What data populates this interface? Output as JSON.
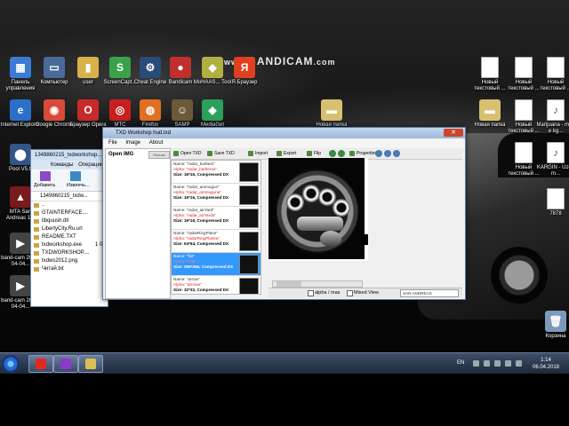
{
  "watermark": {
    "main": "BANDICAM",
    "suffix": ".com",
    "prefix": "www."
  },
  "desktop_icons": [
    {
      "id": "control-panel",
      "label": "Панель управления",
      "color": "#3b7bd6",
      "glyph": "▦"
    },
    {
      "id": "computer",
      "label": "Компьютер",
      "color": "#4a6a9a",
      "glyph": "▭"
    },
    {
      "id": "user",
      "label": "user",
      "color": "#d6b24a",
      "glyph": "▮"
    },
    {
      "id": "screencapture",
      "label": "ScreenCapt...",
      "color": "#3aa04a",
      "glyph": "S"
    },
    {
      "id": "cheat-engine",
      "label": "Cheat Engine",
      "color": "#2a4a7a",
      "glyph": "⚙"
    },
    {
      "id": "bandicam",
      "label": "Bandicam",
      "color": "#c03030",
      "glyph": "●"
    },
    {
      "id": "mohaas-tool",
      "label": "MoHAAS... Tool",
      "color": "#b0b040",
      "glyph": "◆"
    },
    {
      "id": "ya-browser",
      "label": "Я.Браузер",
      "color": "#e04020",
      "glyph": "Я"
    },
    {
      "id": "internet-explorer",
      "label": "Internet Explorer",
      "color": "#2a70c8",
      "glyph": "e"
    },
    {
      "id": "google-chrome",
      "label": "Google Chrome",
      "color": "#d84a3a",
      "glyph": "◉"
    },
    {
      "id": "browser-opera",
      "label": "Браузер Opera",
      "color": "#c82a2a",
      "glyph": "O"
    },
    {
      "id": "mtc",
      "label": "MTC",
      "color": "#c82020",
      "glyph": "◎"
    },
    {
      "id": "firefox",
      "label": "Firefox",
      "color": "#e07020",
      "glyph": "◍"
    },
    {
      "id": "samp",
      "label": "SAMP",
      "color": "#6a5a3a",
      "glyph": "☺"
    },
    {
      "id": "mediaget",
      "label": "MediaGet",
      "color": "#2aa05a",
      "glyph": "◈"
    },
    {
      "id": "pool",
      "label": "Pool V5.0",
      "color": "#335588",
      "glyph": "⬤"
    },
    {
      "id": "mta-san-andreas",
      "label": "MTA San Andreas 1.5",
      "color": "#7a1a1a",
      "glyph": "▲"
    },
    {
      "id": "bandicam-video-1",
      "label": "band-cam 2018-04-04...",
      "color": "#444444",
      "glyph": "▶"
    },
    {
      "id": "bandicam-video-2",
      "label": "band-cam 2018-04-04...",
      "color": "#444444",
      "glyph": "▶"
    },
    {
      "id": "new-folder-1",
      "label": "Новая папка",
      "color": "#d8c070",
      "glyph": "▬"
    },
    {
      "id": "new-doc-1",
      "label": "Новый текстовый ...",
      "color": "#ffffff",
      "glyph": ""
    },
    {
      "id": "new-doc-2",
      "label": "Новый текстовый ...",
      "color": "#ffffff",
      "glyph": ""
    },
    {
      "id": "new-doc-3",
      "label": "Новый текстовый ...",
      "color": "#ffffff",
      "glyph": ""
    },
    {
      "id": "new-folder-2",
      "label": "Новая папка",
      "color": "#d8c070",
      "glyph": "▬"
    },
    {
      "id": "new-doc-4",
      "label": "Новый текстовый ...",
      "color": "#ffffff",
      "glyph": ""
    },
    {
      "id": "marijuana",
      "label": "Marijuana - mek e kg...",
      "color": "#ffffff",
      "glyph": "♪"
    },
    {
      "id": "new-doc-5",
      "label": "Новый текстовый ...",
      "color": "#ffffff",
      "glyph": ""
    },
    {
      "id": "kargin",
      "label": "KARGIN - Uzog m...",
      "color": "#ffffff",
      "glyph": "♪"
    },
    {
      "id": "7878",
      "label": "7878",
      "color": "#ffffff",
      "glyph": ""
    },
    {
      "id": "recycle-bin",
      "label": "Корзина",
      "color": "#7a9ab8",
      "glyph": "🗑"
    }
  ],
  "explorer": {
    "title": "1349860215_txdworkshop...",
    "menu": [
      "Команды",
      "Операции"
    ],
    "ribbon": [
      "Добавить",
      "Извлечь..."
    ],
    "path": "1349860215_txdw...",
    "files": [
      "..",
      "GTAINTERFACE....",
      "libquush.dll",
      "LibertyCity.Ru.url",
      "README.TXT",
      "txdworkshop.exe",
      "TXDWORKSHOP....",
      "txdws2012.png",
      "Читай.txt"
    ],
    "sizes": [
      "",
      "",
      "",
      "",
      "",
      "1 0",
      "",
      "",
      ""
    ]
  },
  "txd": {
    "title": "TXD Workshop  hud.txd",
    "menu": [
      "File",
      "Image",
      "About"
    ],
    "left_header": "Open IMG",
    "left_button": "Rebuild",
    "toolbar": [
      "Open TXD",
      "Save TXD",
      "Import",
      "Export",
      "Flip",
      "Properties"
    ],
    "entries": [
      {
        "name": "Name: \"radar_barbers\"",
        "alpha": "Alpha: \"radar_barbersa\"",
        "size": "Size: 16*16, Compressed DX"
      },
      {
        "name": "Name: \"radar_ammugun\"",
        "alpha": "Alpha: \"radar_ammuguna\"",
        "size": "Size: 16*16, Compressed DX"
      },
      {
        "name": "Name: \"radar_airYard\"",
        "alpha": "Alpha: \"radar_airYarda\"",
        "size": "Size: 16*16, Compressed DX"
      },
      {
        "name": "Name: \"radarRingPlane\"",
        "alpha": "Alpha: \"radarRingPlanea\"",
        "size": "Size: 64*64, Compressed DX"
      },
      {
        "name": "Name: \"fist\"",
        "alpha": "Alpha: \"fista\"",
        "size": "Size: 256*256, Compressed DX"
      },
      {
        "name": "Name: \"arrow\"",
        "alpha": "Alpha: \"arrowa\"",
        "size": "Size: 32*32, Compressed DX"
      }
    ],
    "selected_entry_index": 4,
    "status": {
      "alpha_label": "alpha / mas",
      "mixed_label": "Mixed View",
      "game": "SAN ANDREAS"
    }
  },
  "taskbar": {
    "language": "EN",
    "time": "1:14",
    "date": "06.04.2018"
  }
}
